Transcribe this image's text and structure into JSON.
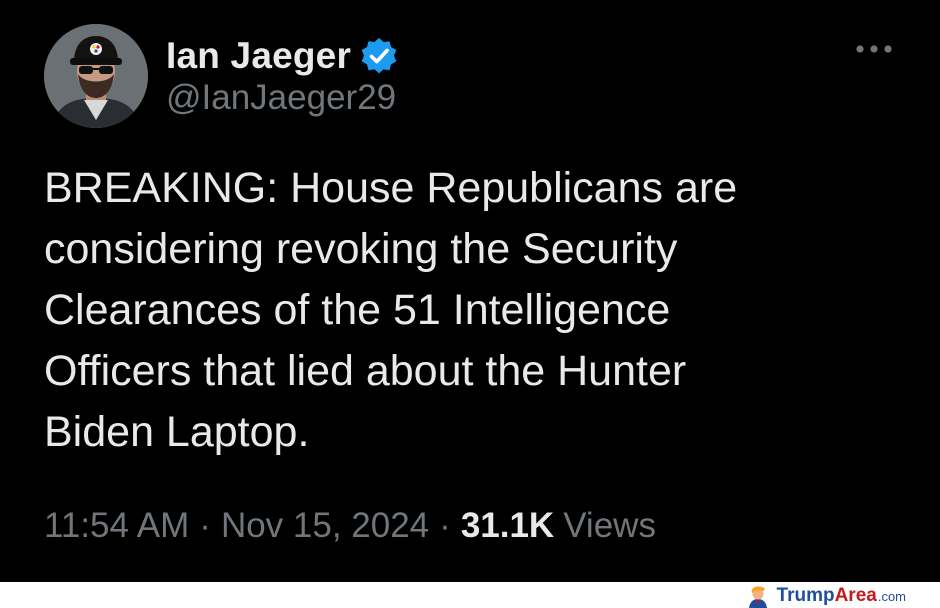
{
  "tweet": {
    "author": {
      "display_name": "Ian Jaeger",
      "handle": "@IanJaeger29",
      "verified": true,
      "avatar_icon": "man-with-cap-avatar"
    },
    "text_lines": [
      "BREAKING: House Republicans are",
      "considering revoking the Security",
      "Clearances of the 51 Intelligence",
      "Officers that lied about the Hunter",
      "Biden Laptop."
    ],
    "meta": {
      "time": "11:54 AM",
      "separator": "·",
      "date": "Nov 15, 2024",
      "views_count": "31.1K",
      "views_label": "Views"
    },
    "more_icon": "more-horizontal-icon"
  },
  "watermark": {
    "brand_part1": "Trump",
    "brand_part2": "Area",
    "brand_suffix": ".com"
  },
  "colors": {
    "background": "#000000",
    "primary_text": "#e7e9ea",
    "secondary_text": "#71767b",
    "verified_badge": "#1d9bf0",
    "watermark_blue": "#1f4e9c",
    "watermark_red": "#c51a1a"
  }
}
